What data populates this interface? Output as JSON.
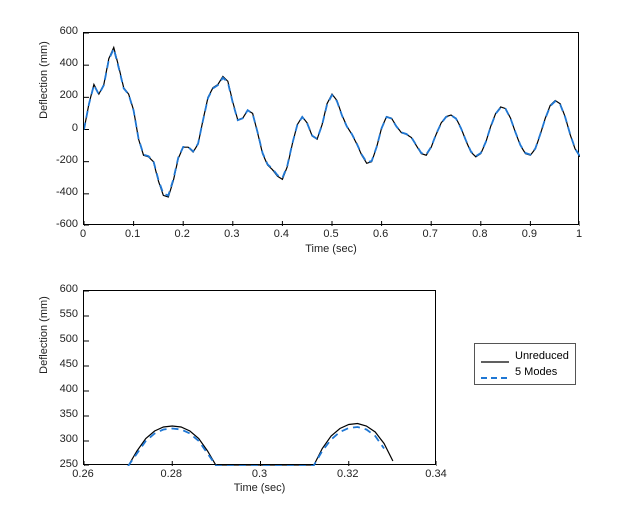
{
  "chart_data": [
    {
      "type": "line",
      "title": "",
      "xlabel": "Time (sec)",
      "ylabel": "Deflection (mm)",
      "xlim": [
        0,
        1
      ],
      "ylim": [
        -600,
        600
      ],
      "xticks": [
        0,
        0.1,
        0.2,
        0.3,
        0.4,
        0.5,
        0.6,
        0.7,
        0.8,
        0.9,
        1
      ],
      "yticks": [
        -600,
        -400,
        -200,
        0,
        200,
        400,
        600
      ],
      "series": [
        {
          "name": "Unreduced",
          "style": "solid",
          "color": "#000000",
          "x": [
            0.0,
            0.01,
            0.02,
            0.03,
            0.04,
            0.05,
            0.06,
            0.07,
            0.08,
            0.09,
            0.1,
            0.11,
            0.12,
            0.13,
            0.14,
            0.15,
            0.16,
            0.17,
            0.18,
            0.19,
            0.2,
            0.21,
            0.22,
            0.23,
            0.24,
            0.25,
            0.26,
            0.27,
            0.28,
            0.29,
            0.3,
            0.31,
            0.32,
            0.33,
            0.34,
            0.35,
            0.36,
            0.37,
            0.38,
            0.39,
            0.4,
            0.41,
            0.42,
            0.43,
            0.44,
            0.45,
            0.46,
            0.47,
            0.48,
            0.49,
            0.5,
            0.51,
            0.52,
            0.53,
            0.54,
            0.55,
            0.56,
            0.57,
            0.58,
            0.59,
            0.6,
            0.61,
            0.62,
            0.63,
            0.64,
            0.65,
            0.66,
            0.67,
            0.68,
            0.69,
            0.7,
            0.71,
            0.72,
            0.73,
            0.74,
            0.75,
            0.76,
            0.77,
            0.78,
            0.79,
            0.8,
            0.81,
            0.82,
            0.83,
            0.84,
            0.85,
            0.86,
            0.87,
            0.88,
            0.89,
            0.9,
            0.91,
            0.92,
            0.93,
            0.94,
            0.95,
            0.96,
            0.97,
            0.98,
            0.99,
            1.0
          ],
          "y": [
            0,
            160,
            280,
            220,
            280,
            440,
            510,
            390,
            260,
            220,
            120,
            -60,
            -160,
            -170,
            -200,
            -320,
            -410,
            -420,
            -320,
            -180,
            -110,
            -110,
            -140,
            -90,
            60,
            200,
            260,
            280,
            330,
            300,
            170,
            60,
            70,
            120,
            100,
            -20,
            -150,
            -220,
            -250,
            -290,
            -310,
            -230,
            -90,
            30,
            80,
            40,
            -40,
            -60,
            30,
            160,
            220,
            180,
            90,
            20,
            -30,
            -90,
            -160,
            -210,
            -200,
            -110,
            10,
            80,
            70,
            20,
            -20,
            -30,
            -50,
            -100,
            -150,
            -160,
            -110,
            -30,
            40,
            80,
            90,
            70,
            10,
            -70,
            -140,
            -170,
            -150,
            -80,
            20,
            100,
            140,
            130,
            70,
            -20,
            -100,
            -150,
            -160,
            -120,
            -30,
            70,
            150,
            180,
            160,
            80,
            -30,
            -120,
            -170
          ]
        },
        {
          "name": "5 Modes",
          "style": "dashed",
          "color": "#1f77d4",
          "x": [
            0.0,
            0.01,
            0.02,
            0.03,
            0.04,
            0.05,
            0.06,
            0.07,
            0.08,
            0.09,
            0.1,
            0.11,
            0.12,
            0.13,
            0.14,
            0.15,
            0.16,
            0.17,
            0.18,
            0.19,
            0.2,
            0.21,
            0.22,
            0.23,
            0.24,
            0.25,
            0.26,
            0.27,
            0.28,
            0.29,
            0.3,
            0.31,
            0.32,
            0.33,
            0.34,
            0.35,
            0.36,
            0.37,
            0.38,
            0.39,
            0.4,
            0.41,
            0.42,
            0.43,
            0.44,
            0.45,
            0.46,
            0.47,
            0.48,
            0.49,
            0.5,
            0.51,
            0.52,
            0.53,
            0.54,
            0.55,
            0.56,
            0.57,
            0.58,
            0.59,
            0.6,
            0.61,
            0.62,
            0.63,
            0.64,
            0.65,
            0.66,
            0.67,
            0.68,
            0.69,
            0.7,
            0.71,
            0.72,
            0.73,
            0.74,
            0.75,
            0.76,
            0.77,
            0.78,
            0.79,
            0.8,
            0.81,
            0.82,
            0.83,
            0.84,
            0.85,
            0.86,
            0.87,
            0.88,
            0.89,
            0.9,
            0.91,
            0.92,
            0.93,
            0.94,
            0.95,
            0.96,
            0.97,
            0.98,
            0.99,
            1.0
          ],
          "y": [
            0,
            158,
            276,
            218,
            276,
            434,
            502,
            384,
            256,
            218,
            118,
            -58,
            -156,
            -166,
            -196,
            -312,
            -400,
            -410,
            -312,
            -176,
            -108,
            -108,
            -136,
            -88,
            58,
            196,
            256,
            276,
            322,
            294,
            166,
            58,
            70,
            120,
            98,
            -18,
            -146,
            -216,
            -244,
            -284,
            -302,
            -224,
            -88,
            28,
            78,
            38,
            -38,
            -58,
            28,
            156,
            214,
            176,
            88,
            18,
            -28,
            -88,
            -156,
            -204,
            -196,
            -108,
            8,
            78,
            68,
            18,
            -18,
            -28,
            -48,
            -98,
            -146,
            -156,
            -108,
            -28,
            38,
            78,
            88,
            68,
            8,
            -68,
            -136,
            -166,
            -146,
            -78,
            18,
            98,
            136,
            128,
            68,
            -18,
            -98,
            -146,
            -156,
            -118,
            -28,
            68,
            146,
            176,
            156,
            78,
            -28,
            -118,
            -168
          ]
        }
      ]
    },
    {
      "type": "line",
      "title": "",
      "xlabel": "Time (sec)",
      "ylabel": "Deflection (mm)",
      "xlim": [
        0.26,
        0.34
      ],
      "ylim": [
        250,
        600
      ],
      "xticks": [
        0.26,
        0.28,
        0.3,
        0.32,
        0.34
      ],
      "xticklabels": [
        "0.26",
        "0.28",
        "0.3",
        "0.32",
        "0.34"
      ],
      "yticks": [
        250,
        300,
        350,
        400,
        450,
        500,
        550,
        600
      ],
      "series": [
        {
          "name": "Unreduced",
          "style": "solid",
          "color": "#000000",
          "x": [
            0.27,
            0.272,
            0.274,
            0.276,
            0.278,
            0.28,
            0.282,
            0.284,
            0.286,
            0.288,
            0.29,
            0.312,
            0.314,
            0.316,
            0.318,
            0.32,
            0.322,
            0.324,
            0.326,
            0.328,
            0.33
          ],
          "y": [
            250,
            280,
            305,
            320,
            328,
            330,
            328,
            320,
            305,
            280,
            250,
            250,
            285,
            310,
            325,
            333,
            335,
            330,
            318,
            295,
            260
          ]
        },
        {
          "name": "5 Modes",
          "style": "dashed",
          "color": "#1f77d4",
          "x": [
            0.27,
            0.272,
            0.274,
            0.276,
            0.278,
            0.28,
            0.282,
            0.284,
            0.286,
            0.288,
            0.29,
            0.312,
            0.314,
            0.316,
            0.318,
            0.32,
            0.322,
            0.324,
            0.326,
            0.328
          ],
          "y": [
            250,
            275,
            300,
            315,
            323,
            325,
            323,
            315,
            300,
            275,
            250,
            250,
            280,
            303,
            318,
            326,
            328,
            323,
            310,
            285
          ]
        }
      ]
    }
  ],
  "legend": {
    "entries": [
      {
        "label": "Unreduced",
        "style": "solid",
        "color": "#000000"
      },
      {
        "label": "5 Modes",
        "style": "dashed",
        "color": "#1f77d4"
      }
    ]
  }
}
